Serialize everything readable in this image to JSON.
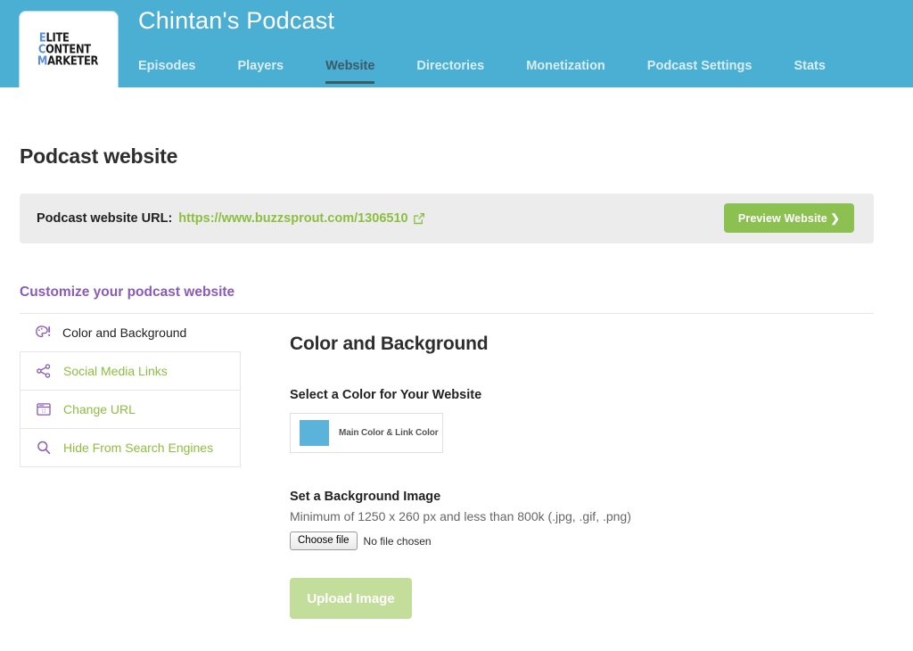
{
  "header": {
    "title": "Chintan's Podcast",
    "logo": {
      "line1_first": "E",
      "line1_rest": "LITE",
      "line2_first": "C",
      "line2_rest": "ONTENT",
      "line3_first": "M",
      "line3_rest": "ARKETER"
    },
    "nav": [
      {
        "label": "Episodes",
        "active": false
      },
      {
        "label": "Players",
        "active": false
      },
      {
        "label": "Website",
        "active": true
      },
      {
        "label": "Directories",
        "active": false
      },
      {
        "label": "Monetization",
        "active": false
      },
      {
        "label": "Podcast Settings",
        "active": false
      },
      {
        "label": "Stats",
        "active": false
      }
    ]
  },
  "page": {
    "title": "Podcast website"
  },
  "url_panel": {
    "label": "Podcast website URL:",
    "url": "https://www.buzzsprout.com/1306510",
    "external_link_icon": "external-link-icon",
    "preview_button": "Preview Website ❯"
  },
  "customize": {
    "heading": "Customize your podcast website",
    "items": [
      {
        "label": "Color and Background",
        "icon": "palette-icon",
        "active": true
      },
      {
        "label": "Social Media Links",
        "icon": "share-icon",
        "active": false
      },
      {
        "label": "Change URL",
        "icon": "browser-window-icon",
        "active": false
      },
      {
        "label": "Hide From Search Engines",
        "icon": "search-icon",
        "active": false
      }
    ]
  },
  "main": {
    "heading": "Color and Background",
    "color_section": {
      "label": "Select a Color for Your Website",
      "swatch_label": "Main Color & Link Color",
      "swatch_color": "#5bb3dc"
    },
    "background_section": {
      "label": "Set a Background Image",
      "hint": "Minimum of 1250 x 260 px and less than 800k (.jpg, .gif, .png)",
      "choose_file_label": "Choose file",
      "no_file_text": "No file chosen",
      "upload_button": "Upload Image"
    }
  },
  "colors": {
    "header_blue": "#4bafd3",
    "link_green": "#8cbf3f",
    "button_green": "#8cc152",
    "button_green_disabled": "#c3dd9b",
    "purple": "#8a5cb8",
    "nav_active": "#3c5b69"
  }
}
